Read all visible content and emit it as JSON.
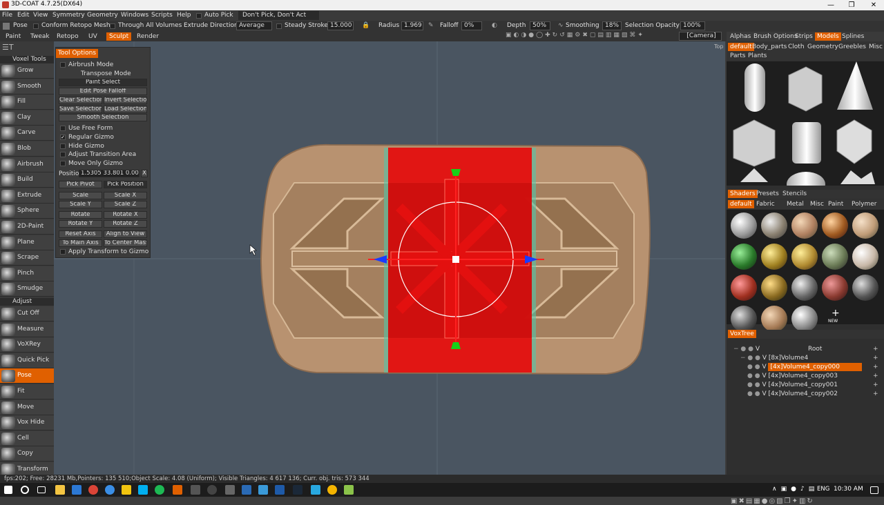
{
  "window": {
    "title": "3D-COAT 4.7.25(DX64)",
    "min": "—",
    "max": "❐",
    "close": "✕"
  },
  "menubar": {
    "items": [
      "File",
      "Edit",
      "View",
      "Symmetry",
      "Geometry",
      "Windows",
      "Scripts",
      "Help"
    ],
    "auto_pick": "Auto Pick",
    "pick_mode": "Don't Pick, Don't Act"
  },
  "toolbar": {
    "pose": "Pose",
    "conform_retopo": "Conform Retopo Mesh",
    "through_all": "Through All Volumes",
    "extrude_direction": "Extrude Direction",
    "extrude_value": "Average",
    "steady_stroke": "Steady Stroke",
    "steady_value": "15.000",
    "radius_label": "Radius",
    "radius_value": "1.969",
    "falloff_label": "Falloff",
    "falloff_value": "0%",
    "depth_label": "Depth",
    "depth_value": "50%",
    "smoothing_label": "Smoothing",
    "smoothing_value": "18%",
    "selection_opacity_label": "Selection Opacity",
    "selection_opacity_value": "100%",
    "camera": "[Camera]"
  },
  "rooms": [
    "Paint",
    "Tweak",
    "Retopo",
    "UV",
    "Sculpt",
    "Render"
  ],
  "active_room": "Sculpt",
  "left_panel": {
    "section1": "Voxel Tools",
    "tools1": [
      "Grow",
      "Smooth",
      "Fill",
      "Clay",
      "Carve",
      "Blob",
      "Airbrush",
      "Build",
      "Extrude",
      "Sphere",
      "2D-Paint",
      "Plane",
      "Scrape",
      "Pinch",
      "Smudge"
    ],
    "section2": "Adjust",
    "tools2": [
      "Cut Off",
      "Measure",
      "VoXRey",
      "Quick Pick",
      "Pose",
      "Fit",
      "Move",
      "Vox Hide",
      "Cell",
      "Copy",
      "Transform"
    ]
  },
  "tool_options": {
    "title": "Tool Options",
    "airbrush_mode": "Airbrush Mode",
    "transpose_mode": "Transpose Mode",
    "paint_select": "Paint Select",
    "edit_pose_falloff": "Edit Pose Falloff",
    "clear_selection": "Clear Selection",
    "invert_selection": "Invert Selectio",
    "save_selection": "Save Selection",
    "load_selection": "Load Selection",
    "smooth_selection": "Smooth Selection",
    "use_free_form": "Use Free Form",
    "regular_gizmo": "Regular Gizmo",
    "hide_gizmo": "Hide Gizmo",
    "adjust_transition": "Adjust Transition Area",
    "move_only_gizmo": "Move Only Gizmo",
    "position_label": "Positio",
    "position_value": "1.5305 33.801 0.0013",
    "position_x": "X",
    "pick_pivot": "Pick Pivot",
    "pick_position": "Pick Position",
    "scale": "Scale",
    "scale_x": "Scale X",
    "scale_y": "Scale Y",
    "scale_z": "Scale Z",
    "rotate": "Rotate",
    "rotate_x": "Rotate X",
    "rotate_y": "Rotate Y",
    "rotate_z": "Rotate Z",
    "reset_axis": "Reset Axis",
    "align_to_view": "Align to View",
    "to_main_axis": "To Main Axis",
    "to_center_mass": "To Center Mass",
    "apply_transform": "Apply Transform to Gizmo",
    "regular_gizmo_checked": "✓"
  },
  "viewport": {
    "corner_label": "Top"
  },
  "right_panel": {
    "tabs1": [
      "Alphas",
      "Brush Options",
      "Strips",
      "Models",
      "Splines"
    ],
    "active_tab1": "Models",
    "model_cats": [
      "default",
      "Body_parts",
      "Cloth",
      "Geometry",
      "Greebles",
      "Misc",
      "Parts",
      "Plants"
    ],
    "tabs2": [
      "Shaders",
      "Presets",
      "Stencils"
    ],
    "shader_cats": [
      "default",
      "Fabric",
      "Metal",
      "Misc",
      "Paint",
      "Polymer"
    ],
    "new_label": "NEW",
    "voxtree_title": "VoxTree",
    "tree": [
      "Root",
      "[8x]Volume4",
      "[4x]Volume4_copy000",
      "[4x]Volume4_copy003",
      "[4x]Volume4_copy001",
      "[4x]Volume4_copy002"
    ],
    "tree_v": "V"
  },
  "status": "fps:202;   Free: 28231 Mb,Pointers: 135 510;Object Scale: 4.08 (Uniform); Visible Triangles: 4 617 136; Curr. obj. tris: 573 344",
  "taskbar": {
    "lang": "ENG",
    "time": "10:30 AM"
  }
}
